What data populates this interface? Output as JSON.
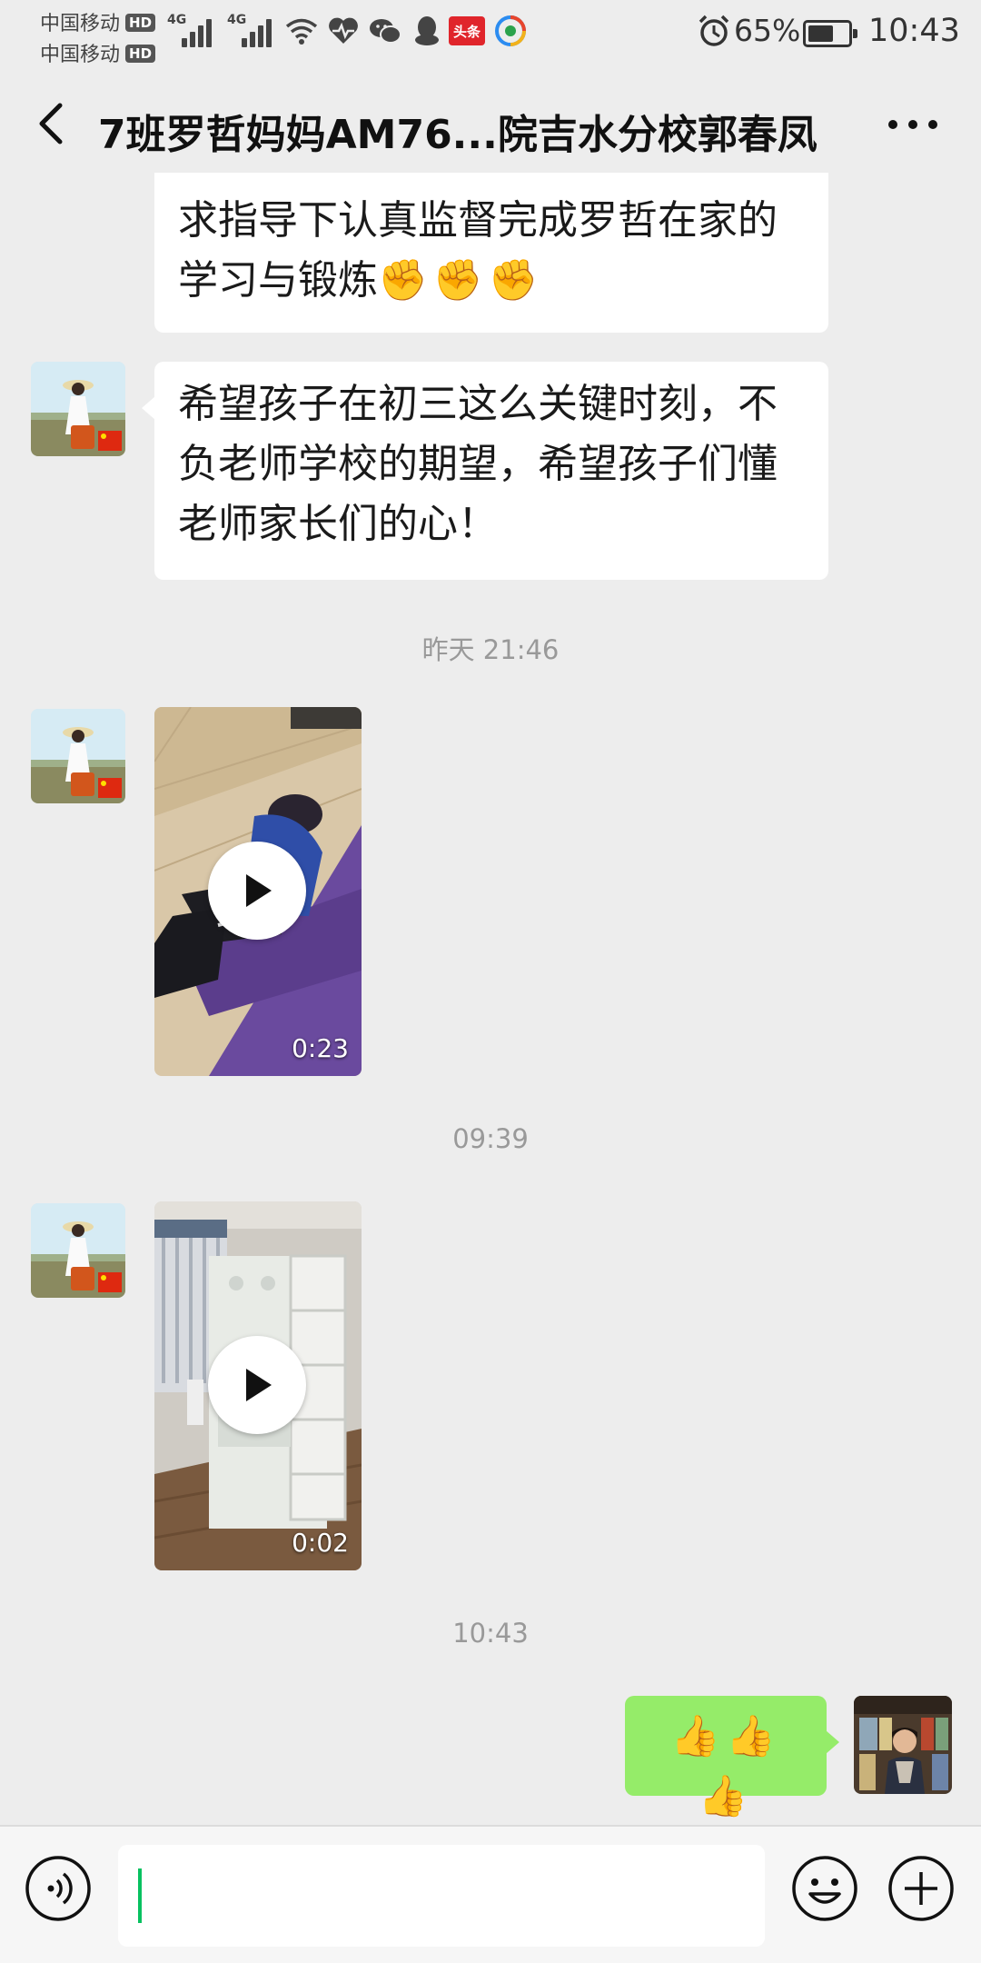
{
  "status_bar": {
    "carrier1": "中国移动",
    "carrier2": "中国移动",
    "hd_label": "HD",
    "network": "4G",
    "news_app_label": "头条",
    "battery_percent": "65%",
    "battery_level": 0.65,
    "time": "10:43"
  },
  "header": {
    "title": "7班罗哲妈妈AM76...院吉水分校郭春凤"
  },
  "messages": [
    {
      "type": "text",
      "sender": "other",
      "text_line1": "求指导下认真监督完成罗哲在家的",
      "text_line2": "学习与锻炼",
      "emoji": "✊✊✊"
    },
    {
      "type": "text",
      "sender": "other",
      "text_line1": "希望孩子在初三这么关键时刻，不",
      "text_line2": "负老师学校的期望，希望孩子们懂",
      "text_line3": "老师家长们的心！"
    },
    {
      "type": "timestamp",
      "text": "昨天 21:46"
    },
    {
      "type": "video",
      "sender": "other",
      "duration": "0:23"
    },
    {
      "type": "timestamp",
      "text": "09:39"
    },
    {
      "type": "video",
      "sender": "other",
      "duration": "0:02"
    },
    {
      "type": "timestamp",
      "text": "10:43"
    },
    {
      "type": "text",
      "sender": "me",
      "emoji": "👍👍👍"
    }
  ],
  "input_bar": {
    "placeholder": ""
  },
  "colors": {
    "background": "#ededed",
    "my_bubble": "#95ec69",
    "other_bubble": "#ffffff",
    "cursor": "#07c160"
  },
  "icons": [
    "back-arrow-icon",
    "more-icon",
    "voice-icon",
    "emoji-icon",
    "plus-icon",
    "play-icon",
    "alarm-icon",
    "wifi-icon",
    "heart-rate-icon",
    "wechat-icon",
    "qq-icon"
  ]
}
